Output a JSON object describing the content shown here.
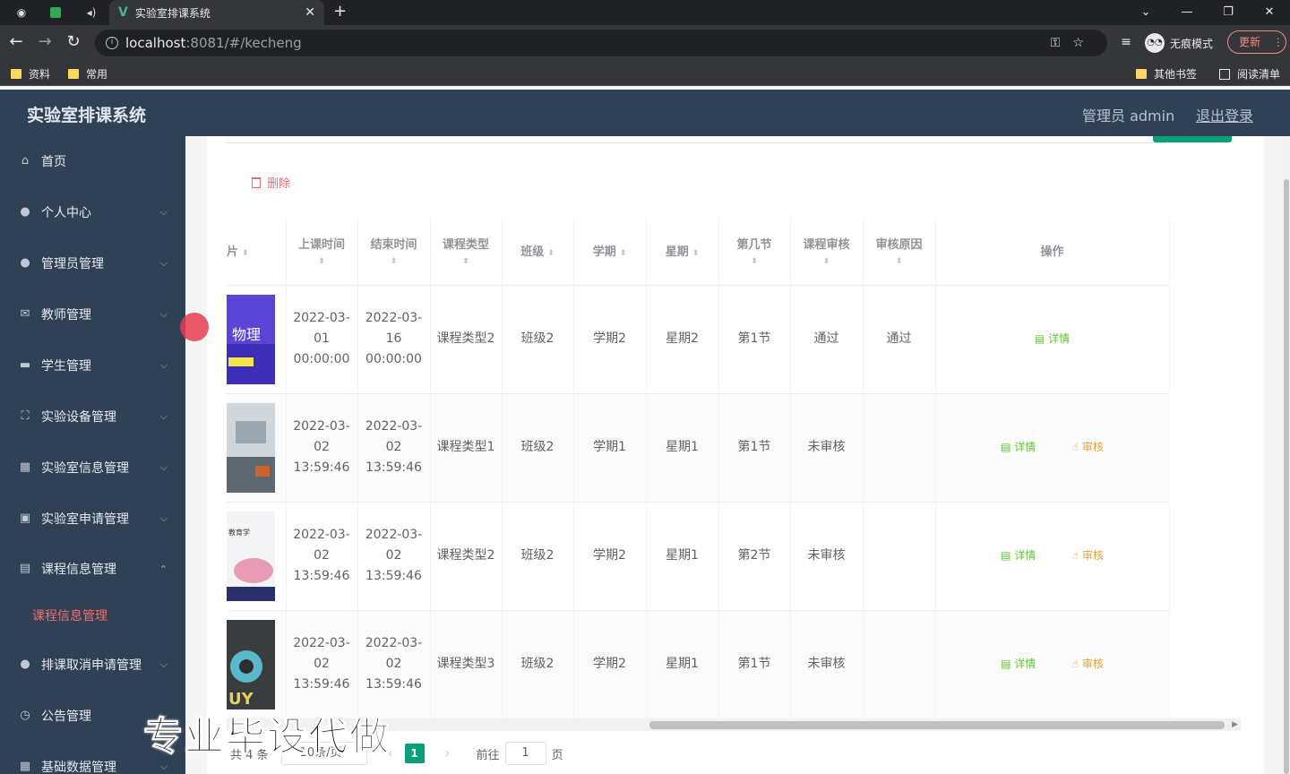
{
  "browser": {
    "tab_title": "实验室排课系统",
    "url_host": "localhost",
    "url_path": ":8081/#/kecheng",
    "incognito_label": "无痕模式",
    "update_label": "更新",
    "bookmarks": [
      "资料",
      "常用"
    ],
    "bookmarks_right": [
      "其他书签",
      "阅读清单"
    ]
  },
  "header": {
    "title": "实验室排课系统",
    "admin_label": "管理员 admin",
    "logout_label": "退出登录"
  },
  "sidebar": {
    "items": [
      {
        "label": "首页",
        "icon": "home-icon"
      },
      {
        "label": "个人中心",
        "icon": "user-icon"
      },
      {
        "label": "管理员管理",
        "icon": "user-icon"
      },
      {
        "label": "教师管理",
        "icon": "mail-icon"
      },
      {
        "label": "学生管理",
        "icon": "briefcase-icon"
      },
      {
        "label": "实验设备管理",
        "icon": "fullscreen-icon"
      },
      {
        "label": "实验室信息管理",
        "icon": "grid-icon"
      },
      {
        "label": "实验室申请管理",
        "icon": "document-icon"
      },
      {
        "label": "课程信息管理",
        "icon": "document-icon"
      },
      {
        "label": "排课取消申请管理",
        "icon": "user-icon"
      },
      {
        "label": "公告管理",
        "icon": "clock-icon"
      },
      {
        "label": "基础数据管理",
        "icon": "grid-icon"
      }
    ],
    "active_sub": "课程信息管理"
  },
  "main": {
    "delete_label": "删除",
    "columns": [
      "片",
      "上课时间",
      "结束时间",
      "课程类型",
      "班级",
      "学期",
      "星期",
      "第几节",
      "课程审核",
      "审核原因",
      "操作"
    ],
    "rows": [
      {
        "thumb_text": "物理",
        "start": "2022-03-01 00:00:00",
        "end": "2022-03-16 00:00:00",
        "type": "课程类型2",
        "class": "班级2",
        "term": "学期2",
        "week": "星期2",
        "period": "第1节",
        "audit": "通过",
        "reason": "通过",
        "detail": "详情",
        "review": ""
      },
      {
        "thumb_text": "",
        "start": "2022-03-02 13:59:46",
        "end": "2022-03-02 13:59:46",
        "type": "课程类型1",
        "class": "班级2",
        "term": "学期1",
        "week": "星期1",
        "period": "第1节",
        "audit": "未审核",
        "reason": "",
        "detail": "详情",
        "review": "审核"
      },
      {
        "thumb_text": "教育学",
        "start": "2022-03-02 13:59:46",
        "end": "2022-03-02 13:59:46",
        "type": "课程类型2",
        "class": "班级2",
        "term": "学期2",
        "week": "星期1",
        "period": "第2节",
        "audit": "未审核",
        "reason": "",
        "detail": "详情",
        "review": "审核"
      },
      {
        "thumb_text": "UY",
        "start": "2022-03-02 13:59:46",
        "end": "2022-03-02 13:59:46",
        "type": "课程类型3",
        "class": "班级2",
        "term": "学期2",
        "week": "星期1",
        "period": "第1节",
        "audit": "未审核",
        "reason": "",
        "detail": "详情",
        "review": "审核"
      }
    ],
    "pager": {
      "total": "共 4 条",
      "page_size": "10条/页",
      "current": "1",
      "goto_label": "前往",
      "goto_value": "1",
      "page_suffix": "页"
    }
  },
  "watermark": "专业毕设代做",
  "colors": {
    "sidebar": "#304156",
    "accent": "#0aa077",
    "danger": "#f56c6c",
    "success": "#67c23a",
    "warning": "#e6a23c"
  }
}
